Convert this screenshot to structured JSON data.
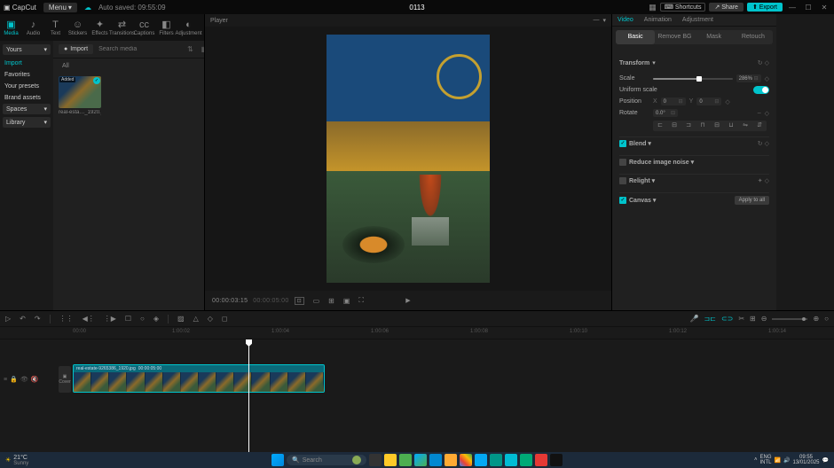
{
  "titlebar": {
    "app": "CapCut",
    "menu": "Menu",
    "saved": "Auto saved: 09:55:09",
    "project": "0113",
    "shortcuts": "Shortcuts",
    "share": "Share",
    "export": "Export"
  },
  "toolTabs": [
    {
      "id": "media",
      "label": "Media",
      "icon": "▣",
      "active": true
    },
    {
      "id": "audio",
      "label": "Audio",
      "icon": "♪"
    },
    {
      "id": "text",
      "label": "Text",
      "icon": "T"
    },
    {
      "id": "stickers",
      "label": "Stickers",
      "icon": "☺"
    },
    {
      "id": "effects",
      "label": "Effects",
      "icon": "✦"
    },
    {
      "id": "transitions",
      "label": "Transitions",
      "icon": "⇄"
    },
    {
      "id": "captions",
      "label": "Captions",
      "icon": "cc"
    },
    {
      "id": "filters",
      "label": "Filters",
      "icon": "◧"
    },
    {
      "id": "adjustment",
      "label": "Adjustment",
      "icon": "◐"
    }
  ],
  "leftSub": {
    "yours": "Yours",
    "items": [
      "Import",
      "Favorites",
      "Your presets",
      "Brand assets"
    ],
    "spaces": "Spaces",
    "library": "Library"
  },
  "mediaHead": {
    "import": "Import",
    "searchPh": "Search media"
  },
  "mediaTabs": {
    "all": "All"
  },
  "thumb": {
    "badge": "Added",
    "caption": "real-esta…_1920.jpg"
  },
  "player": {
    "label": "Player",
    "tc1": "00:00:03:15",
    "tc2": "00:00:05:00"
  },
  "rightTabs": [
    "Video",
    "Animation",
    "Adjustment"
  ],
  "rightSub": [
    "Basic",
    "Remove BG",
    "Mask",
    "Retouch"
  ],
  "transform": {
    "title": "Transform",
    "scale": "Scale",
    "scaleVal": "286%",
    "scalePos": 58,
    "uniform": "Uniform scale",
    "position": "Position",
    "posX": "0",
    "posY": "0",
    "rotate": "Rotate",
    "rotVal": "0.0°"
  },
  "sections": {
    "blend": "Blend",
    "noise": "Reduce image noise",
    "relight": "Relight",
    "canvas": "Canvas",
    "applyAll": "Apply to all"
  },
  "ruler": [
    "00:00",
    "1:00:02",
    "1:00:04",
    "1:00:06",
    "1:00:08",
    "1:00:10",
    "1:00:12",
    "1:00:14"
  ],
  "clip": {
    "name": "real-estate-9265386_1920.jpg",
    "dur": "00:00:05:00"
  },
  "cover": "Cover",
  "taskbar": {
    "temp": "21°C",
    "cond": "Sunny",
    "search": "Search",
    "lang": "ENG",
    "kb": "INTL",
    "time": "09:55",
    "date": "13/01/2025"
  }
}
